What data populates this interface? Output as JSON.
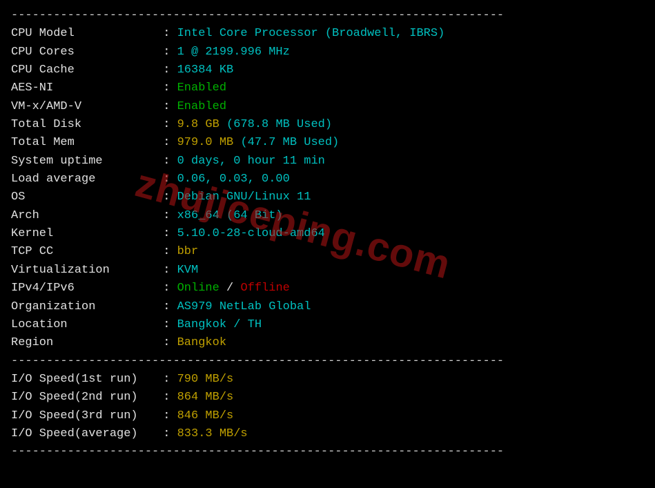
{
  "divider": "----------------------------------------------------------------------",
  "watermark": "zhujiceping.com",
  "system": {
    "cpu_model": {
      "label": "CPU Model",
      "value": "Intel Core Processor (Broadwell, IBRS)"
    },
    "cpu_cores": {
      "label": "CPU Cores",
      "value": "1 @ 2199.996 MHz"
    },
    "cpu_cache": {
      "label": "CPU Cache",
      "value": "16384 KB"
    },
    "aes_ni": {
      "label": "AES-NI",
      "value": "Enabled"
    },
    "vmx": {
      "label": "VM-x/AMD-V",
      "value": "Enabled"
    },
    "total_disk": {
      "label": "Total Disk",
      "value": "9.8 GB",
      "used": "(678.8 MB Used)"
    },
    "total_mem": {
      "label": "Total Mem",
      "value": "979.0 MB",
      "used": "(47.7 MB Used)"
    },
    "uptime": {
      "label": "System uptime",
      "value": "0 days, 0 hour 11 min"
    },
    "load": {
      "label": "Load average",
      "value": "0.06, 0.03, 0.00"
    },
    "os": {
      "label": "OS",
      "value": "Debian GNU/Linux 11"
    },
    "arch": {
      "label": "Arch",
      "value": "x86_64 (64 Bit)"
    },
    "kernel": {
      "label": "Kernel",
      "value": "5.10.0-28-cloud-amd64"
    },
    "tcp_cc": {
      "label": "TCP CC",
      "value": "bbr"
    },
    "virt": {
      "label": "Virtualization",
      "value": "KVM"
    },
    "ipv": {
      "label": "IPv4/IPv6",
      "v4": "Online",
      "sep": " / ",
      "v6": "Offline"
    },
    "org": {
      "label": "Organization",
      "value": "AS979 NetLab Global"
    },
    "location": {
      "label": "Location",
      "value": "Bangkok / TH"
    },
    "region": {
      "label": "Region",
      "value": "Bangkok"
    }
  },
  "io": {
    "run1": {
      "label": "I/O Speed(1st run)",
      "value": "790 MB/s"
    },
    "run2": {
      "label": "I/O Speed(2nd run)",
      "value": "864 MB/s"
    },
    "run3": {
      "label": "I/O Speed(3rd run)",
      "value": "846 MB/s"
    },
    "avg": {
      "label": "I/O Speed(average)",
      "value": "833.3 MB/s"
    }
  }
}
